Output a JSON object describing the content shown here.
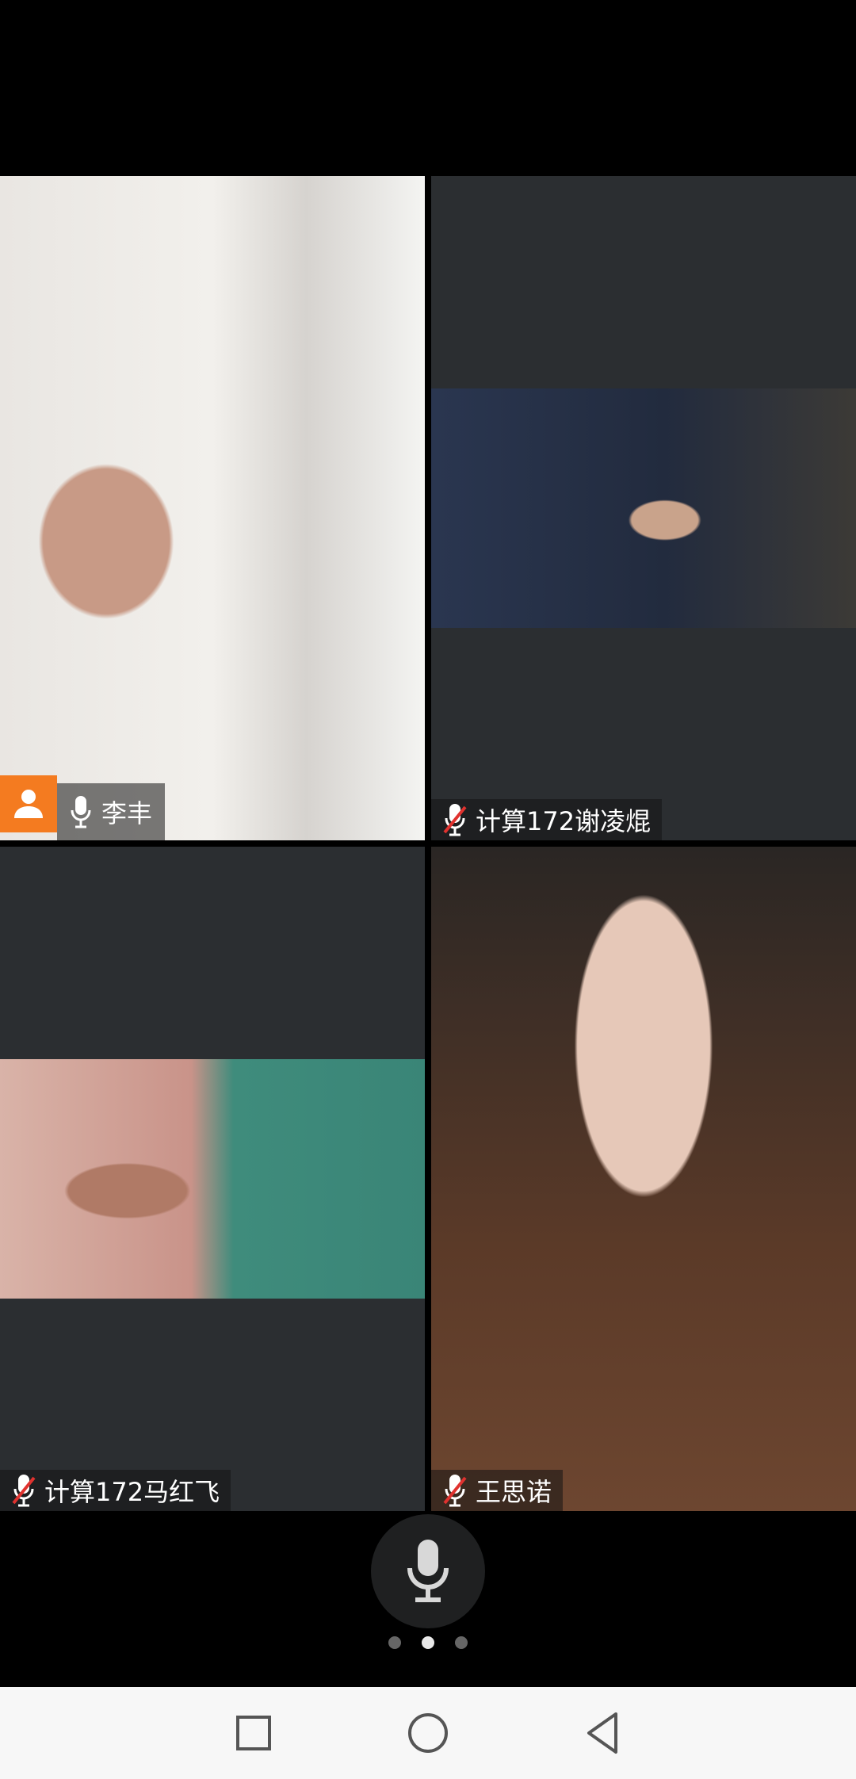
{
  "participants": [
    {
      "name": "李丰",
      "mic": "on",
      "host": true
    },
    {
      "name": "计算172谢凌焜",
      "mic": "muted",
      "host": false
    },
    {
      "name": "计算172马红飞",
      "mic": "muted",
      "host": false
    },
    {
      "name": "王思诺",
      "mic": "muted",
      "host": false
    }
  ],
  "controls": {
    "mic_button_icon": "microphone-icon"
  },
  "pager": {
    "pages": 3,
    "active_page": 2
  },
  "nav": {
    "buttons": [
      "recent-apps-icon",
      "home-icon",
      "back-icon"
    ]
  },
  "colors": {
    "host_badge": "#f47b20",
    "muted_slash": "#e0322f",
    "tile_bg": "#2b2e31"
  }
}
